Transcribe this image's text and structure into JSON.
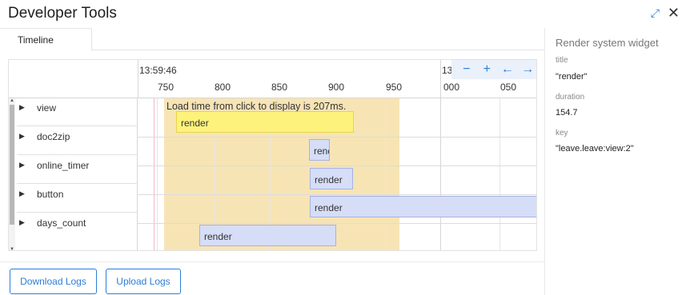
{
  "window": {
    "title": "Developer Tools"
  },
  "tabs": [
    {
      "label": "Timeline"
    }
  ],
  "timeline": {
    "time_label": "13:59:46",
    "time_label_right": "13",
    "ticks": [
      "750",
      "800",
      "850",
      "900",
      "950",
      "000",
      "050"
    ],
    "nav": {
      "zoom_out": "−",
      "zoom_in": "+",
      "prev": "←",
      "next": "→"
    },
    "note": "Load time from click to display is 207ms.",
    "rows": [
      {
        "label": "view",
        "bar": "render"
      },
      {
        "label": "doc2zip",
        "bar": "render"
      },
      {
        "label": "online_timer",
        "bar": "render"
      },
      {
        "label": "button",
        "bar": "render"
      },
      {
        "label": "days_count",
        "bar": "render"
      }
    ]
  },
  "buttons": {
    "download": "Download Logs",
    "upload": "Upload Logs"
  },
  "panel": {
    "title": "Render system widget",
    "props": [
      {
        "key": "title",
        "value": "\"render\""
      },
      {
        "key": "duration",
        "value": "154.7"
      },
      {
        "key": "key",
        "value": "\"leave.leave:view:2\""
      }
    ]
  },
  "colors": {
    "accent": "#2a7ed6",
    "highlight": "#f7e4b5",
    "bar": "#d6ddf7",
    "bar_selected": "#fdf37c"
  }
}
